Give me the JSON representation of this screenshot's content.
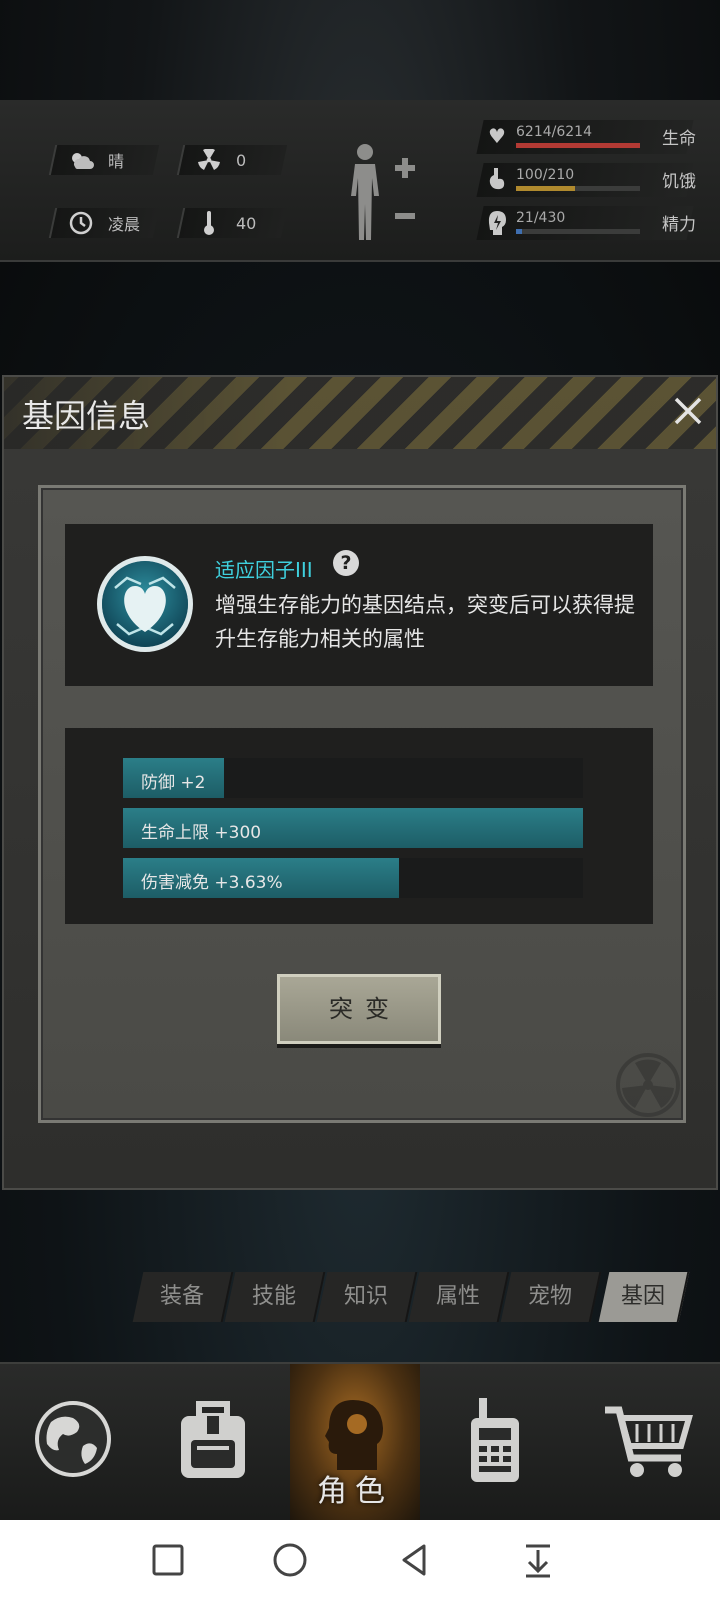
{
  "status": {
    "weather": "晴",
    "radiation": "0",
    "time_of_day": "凌晨",
    "temperature": "40",
    "health": {
      "value": "6214/6214",
      "label": "生命",
      "fraction": 1.0,
      "color": "#b33a34"
    },
    "hunger": {
      "value": "100/210",
      "label": "饥饿",
      "fraction": 0.476,
      "color": "#b08a2e"
    },
    "energy": {
      "value": "21/430",
      "label": "精力",
      "fraction": 0.049,
      "color": "#3f6fb0"
    }
  },
  "modal": {
    "title": "基因信息",
    "gene_name": "适应因子III",
    "help_symbol": "?",
    "description": "增强生存能力的基因结点，突变后可以获得提升生存能力相关的属性",
    "attributes": [
      {
        "label": "防御 +2",
        "fraction": 0.22
      },
      {
        "label": "生命上限 +300",
        "fraction": 1.0
      },
      {
        "label": "伤害减免 +3.63%",
        "fraction": 0.6
      }
    ],
    "mutate_label": "突变"
  },
  "tabs": [
    {
      "label": "装备"
    },
    {
      "label": "技能"
    },
    {
      "label": "知识"
    },
    {
      "label": "属性"
    },
    {
      "label": "宠物"
    },
    {
      "label": "基因",
      "active": true
    }
  ],
  "bottom_nav": [
    {
      "icon": "globe-icon"
    },
    {
      "icon": "backpack-icon"
    },
    {
      "icon": "character-head-icon",
      "label": "角色",
      "active": true
    },
    {
      "icon": "walkie-talkie-icon"
    },
    {
      "icon": "shopping-cart-icon"
    }
  ],
  "system_bar": [
    "recents-button",
    "home-button",
    "back-button",
    "notification-pulldown-button"
  ]
}
